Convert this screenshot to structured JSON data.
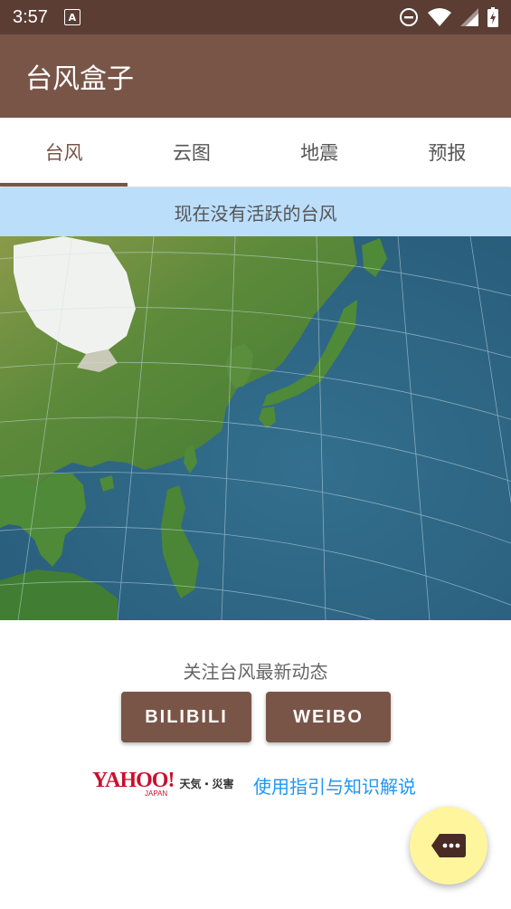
{
  "status_bar": {
    "time": "3:57",
    "notif_letter": "A"
  },
  "app_bar": {
    "title": "台风盒子"
  },
  "tabs": [
    {
      "label": "台风",
      "active": true
    },
    {
      "label": "云图",
      "active": false
    },
    {
      "label": "地震",
      "active": false
    },
    {
      "label": "预报",
      "active": false
    }
  ],
  "banner": {
    "text": "现在没有活跃的台风"
  },
  "follow": {
    "text": "关注台风最新动态"
  },
  "buttons": {
    "bilibili": "BILIBILI",
    "weibo": "WEIBO"
  },
  "yahoo": {
    "logo": "YAHOO!",
    "sub": "JAPAN",
    "tenki": "天気・災害"
  },
  "guide_link": "使用指引与知识解说",
  "colors": {
    "status_bar": "#5b3d34",
    "app_bar": "#795548",
    "banner": "#bbdefb",
    "fab": "#fff59d",
    "link": "#2196f3",
    "yahoo_red": "#c8102e"
  },
  "icons": {
    "dnd": "do-not-disturb-icon",
    "wifi": "wifi-icon",
    "signal": "cell-signal-icon",
    "battery": "battery-icon",
    "fab": "chat-bubble-more-icon"
  }
}
